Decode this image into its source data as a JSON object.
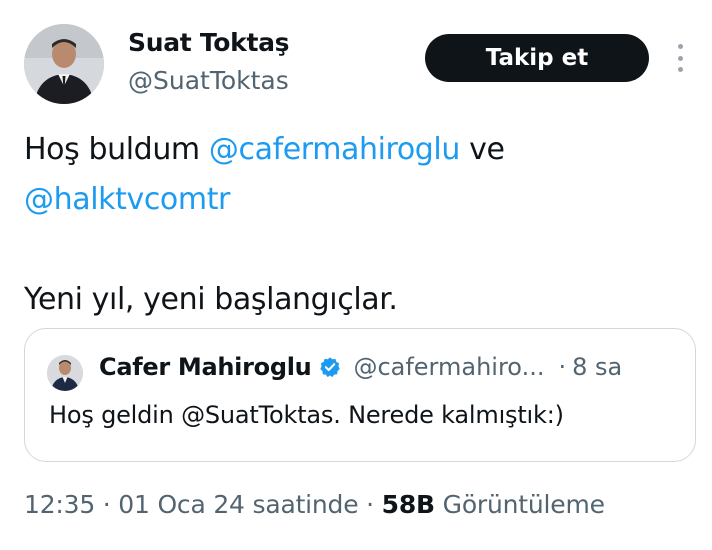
{
  "author": {
    "name": "Suat Toktaş",
    "handle": "@SuatToktas"
  },
  "follow_button": {
    "label": "Takip et"
  },
  "more_icon": "more-vertical-icon",
  "tweet": {
    "line1": {
      "prefix": "Hoş buldum ",
      "mention1": "@cafermahiroglu",
      "suffix": " ve"
    },
    "line2_mention": "@halktvcomtr",
    "line4": "Yeni yıl, yeni başlangıçlar."
  },
  "quote": {
    "name": "Cafer Mahiroglu",
    "verified_icon": "verified-badge-icon",
    "handle": "@cafermahiro...",
    "separator": "·",
    "time": "8 sa",
    "text": "Hoş geldin @SuatToktas. Nerede kalmıştık:)"
  },
  "meta": {
    "time": "12:35",
    "sep1": " · ",
    "date": "01 Oca 24 saatinde",
    "sep2": " · ",
    "views_count": "58B",
    "views_label": " Görüntüleme"
  },
  "colors": {
    "accent": "#1d9bf0",
    "text": "#0f1419",
    "muted": "#536471",
    "border": "#cfd9de",
    "button_bg": "#0f1419"
  }
}
